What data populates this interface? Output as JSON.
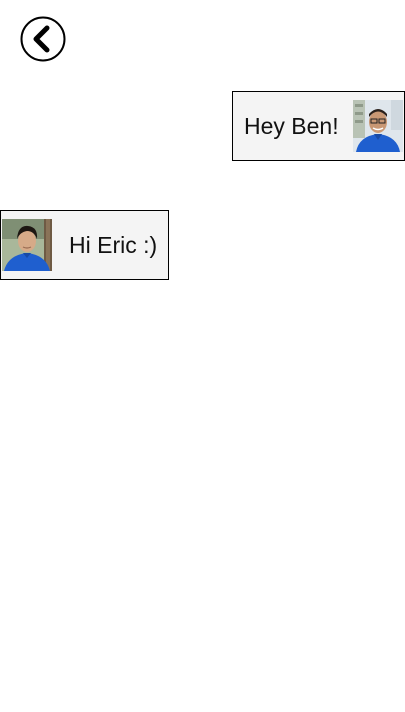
{
  "header": {
    "back_icon": "chevron-left-icon"
  },
  "conversation": {
    "messages": [
      {
        "direction": "outgoing",
        "text": "Hey Ben!",
        "avatar": "avatar-eric"
      },
      {
        "direction": "incoming",
        "text": "Hi Eric :)",
        "avatar": "avatar-ben"
      }
    ]
  },
  "colors": {
    "bubble_background": "#f4f4f4",
    "bubble_border": "#000000",
    "avatar_shirt": "#1f5fcf"
  }
}
